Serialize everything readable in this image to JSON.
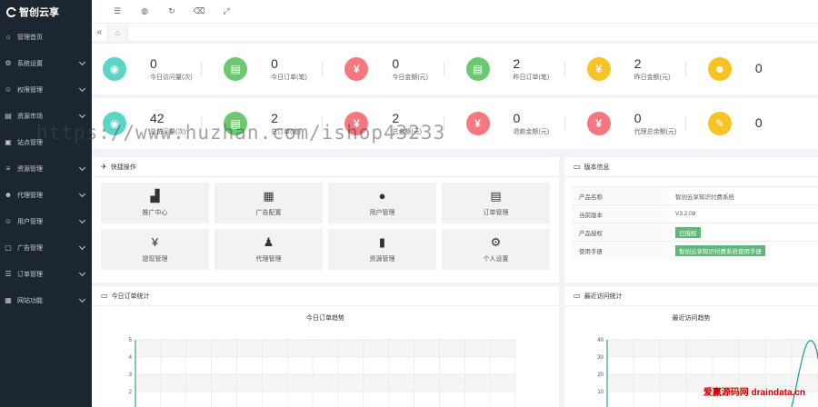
{
  "app": {
    "logo_text": "智创云享"
  },
  "sidebar": {
    "items": [
      {
        "label": "管理首页",
        "icon": "home-icon",
        "glyph": "⌂",
        "has_arrow": false
      },
      {
        "label": "系统设置",
        "icon": "gear-icon",
        "glyph": "⚙",
        "has_arrow": true
      },
      {
        "label": "权限管理",
        "icon": "user-icon",
        "glyph": "☺",
        "has_arrow": true
      },
      {
        "label": "资源市场",
        "icon": "cart-icon",
        "glyph": "▤",
        "has_arrow": true
      },
      {
        "label": "站点管理",
        "icon": "site-icon",
        "glyph": "▣",
        "has_arrow": false
      },
      {
        "label": "资源管理",
        "icon": "database-icon",
        "glyph": "≡",
        "has_arrow": true
      },
      {
        "label": "代理管理",
        "icon": "agent-icon",
        "glyph": "☻",
        "has_arrow": true
      },
      {
        "label": "用户管理",
        "icon": "users-icon",
        "glyph": "☺",
        "has_arrow": true
      },
      {
        "label": "广告管理",
        "icon": "ad-icon",
        "glyph": "▢",
        "has_arrow": true
      },
      {
        "label": "订单管理",
        "icon": "order-icon",
        "glyph": "☰",
        "has_arrow": true
      },
      {
        "label": "网站功能",
        "icon": "grid-icon",
        "glyph": "▦",
        "has_arrow": true
      }
    ]
  },
  "topbar": {
    "icons": [
      {
        "name": "menu-toggle-icon",
        "glyph": "☰"
      },
      {
        "name": "theme-icon",
        "glyph": "◍"
      },
      {
        "name": "refresh-icon",
        "glyph": "↻"
      },
      {
        "name": "trash-icon",
        "glyph": "⌫"
      },
      {
        "name": "fullscreen-icon",
        "glyph": "⤢"
      }
    ]
  },
  "tabs": {
    "collapse_glyph": "«",
    "home_glyph": "⌂"
  },
  "stats_row1": [
    {
      "value": "0",
      "label": "今日访问量(次)",
      "color": "#5dd5c4",
      "glyph": "◉",
      "icon": "eye-icon"
    },
    {
      "value": "0",
      "label": "今日订单(笔)",
      "color": "#6cc96f",
      "glyph": "▤",
      "icon": "clipboard-icon"
    },
    {
      "value": "0",
      "label": "今日金额(元)",
      "color": "#f6777f",
      "glyph": "¥",
      "icon": "yen-icon"
    },
    {
      "value": "2",
      "label": "昨日订单(笔)",
      "color": "#6cc96f",
      "glyph": "▤",
      "icon": "clipboard-icon"
    },
    {
      "value": "2",
      "label": "昨日金额(元)",
      "color": "#f7c325",
      "glyph": "¥",
      "icon": "yen-icon"
    },
    {
      "value": "0",
      "label": "",
      "color": "#f7c325",
      "glyph": "☻",
      "icon": "user-icon"
    }
  ],
  "stats_row2": [
    {
      "value": "42",
      "label": "总访问量(次)",
      "color": "#5dd5c4",
      "glyph": "◉",
      "icon": "eye-icon"
    },
    {
      "value": "2",
      "label": "总订单(笔)",
      "color": "#6cc96f",
      "glyph": "▤",
      "icon": "clipboard-icon"
    },
    {
      "value": "2",
      "label": "总金额(元)",
      "color": "#f6777f",
      "glyph": "¥",
      "icon": "yen-icon"
    },
    {
      "value": "0",
      "label": "退款金额(元)",
      "color": "#f6777f",
      "glyph": "¥",
      "icon": "yen-icon"
    },
    {
      "value": "0",
      "label": "代理总余额(元)",
      "color": "#f6777f",
      "glyph": "¥",
      "icon": "yen-icon"
    },
    {
      "value": "0",
      "label": "",
      "color": "#f7c325",
      "glyph": "✎",
      "icon": "tag-icon"
    }
  ],
  "quick_ops": {
    "title": "快捷操作",
    "items": [
      {
        "label": "推广中心",
        "glyph": "▟",
        "icon": "chart-icon"
      },
      {
        "label": "广告配置",
        "glyph": "▦",
        "icon": "grid-icon"
      },
      {
        "label": "用户管理",
        "glyph": "●",
        "icon": "user-icon"
      },
      {
        "label": "订单管理",
        "glyph": "▤",
        "icon": "order-icon"
      },
      {
        "label": "提现管理",
        "glyph": "¥",
        "icon": "withdraw-icon"
      },
      {
        "label": "代理管理",
        "glyph": "♟",
        "icon": "agent-icon"
      },
      {
        "label": "资源管理",
        "glyph": "▮",
        "icon": "book-icon"
      },
      {
        "label": "个人设置",
        "glyph": "⚙",
        "icon": "gear-icon"
      }
    ]
  },
  "version_info": {
    "title": "版本信息",
    "rows": [
      {
        "label": "产品名称",
        "value": "智创云享知识付费系统",
        "tag": false
      },
      {
        "label": "当前版本",
        "value": "V3.2.08",
        "tag": false
      },
      {
        "label": "产品授权",
        "value": "已授权",
        "tag": true
      },
      {
        "label": "使用手册",
        "value": "智创云享知识付费系统使用手册",
        "tag": true
      }
    ]
  },
  "order_panel": {
    "title": "今日订单统计",
    "chart_title": "今日订单趋势"
  },
  "visit_panel": {
    "title": "最近访问统计",
    "chart_title": "最近访问趋势"
  },
  "chart_data": [
    {
      "type": "line",
      "title": "今日订单趋势",
      "ylim": [
        0,
        5
      ],
      "yticks": [
        "5",
        "4",
        "3",
        "2"
      ],
      "series": []
    },
    {
      "type": "line",
      "title": "最近访问趋势",
      "ylim": [
        0,
        40
      ],
      "yticks": [
        "40",
        "30",
        "20",
        "10"
      ],
      "series": []
    }
  ],
  "watermark": {
    "text": "https://www.huzhan.com/ishop43233",
    "text2": "爱赢源码网 draindata.cn"
  }
}
